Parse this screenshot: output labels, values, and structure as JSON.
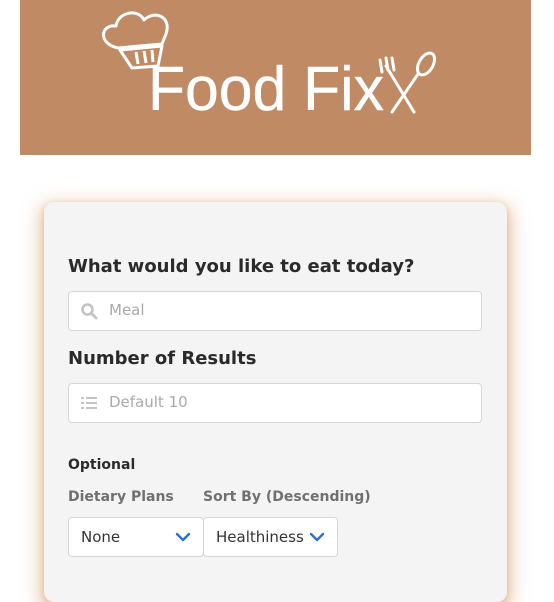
{
  "banner": {
    "brand": "Food Fix",
    "background": "#c08a65"
  },
  "form": {
    "meal_question": "What would you like to eat today?",
    "meal_placeholder": "Meal",
    "meal_icon": "search-icon",
    "results_question": "Number of Results",
    "results_placeholder": "Default 10",
    "results_icon": "list-icon",
    "optional_label": "Optional",
    "dietary_label": "Dietary Plans",
    "dietary_value": "None",
    "sort_label": "Sort By (Descending)",
    "sort_value": "Healthiness",
    "accent": "#2b6fd1"
  }
}
